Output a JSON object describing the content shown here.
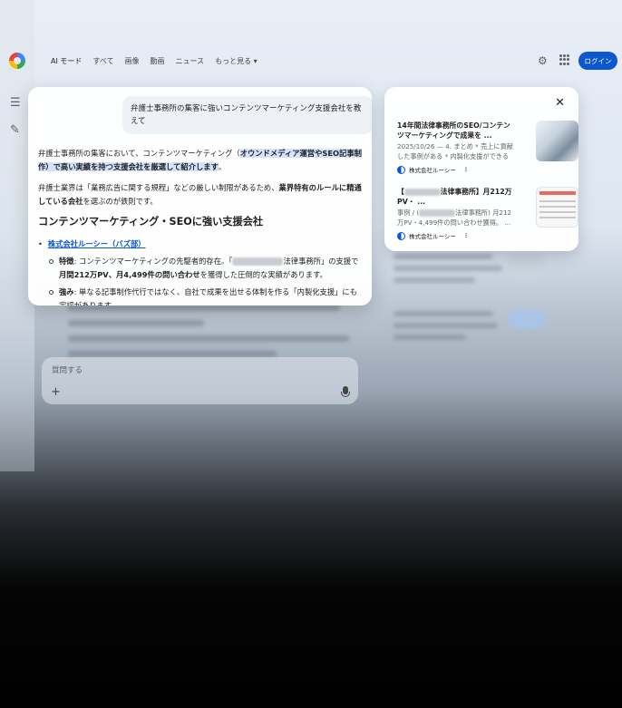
{
  "nav": {
    "tabs": [
      "AI モード",
      "すべて",
      "画像",
      "動画",
      "ニュース",
      "もっと見る ▾"
    ],
    "login_label": "ログイン"
  },
  "chat": {
    "query": "弁護士事務所の集客に強いコンテンツマーケティング支援会社を教えて",
    "intro_plain": "弁護士事務所の集客において、コンテンツマーケティング（",
    "intro_bold": "オウンドメディア運営やSEO記事制作）で高い実績を持つ支援会社を厳選して紹介します",
    "intro_end": "。",
    "para2_plain": "弁護士業界は「業務広告に関する規程」などの厳しい制限があるため、",
    "para2_bold": "業界特有のルールに精通している会社",
    "para2_end": "を選ぶのが鉄則です。",
    "heading": "コンテンツマーケティング・SEOに強い支援会社",
    "company": "株式会社ルーシー（バズ部）",
    "feature_label": "特徴",
    "feature_text_1": ": コンテンツマーケティングの先駆者的存在。「",
    "feature_text_2": "法律事務所」の支援で",
    "feature_bold": "月間212万PV、月4,499件の問い合わせ",
    "feature_end": "を獲得した圧倒的な実績があります。",
    "strength_label": "強み",
    "strength_text": ": 単なる記事制作代行ではなく、自社で成果を出せる体制を作る「内製化支援」にも定評があります。"
  },
  "sources": {
    "items": [
      {
        "title": "14年間法律事務所のSEO/コンテンツマーケティングで成果を ...",
        "snippet": "2025/10/26 — 4. まとめ * 売上に貢献した事例がある * 内製化支援ができる",
        "site": "株式会社ルーシー"
      },
      {
        "title_1": "【",
        "title_2": "法律事務所】月212万PV・ ...",
        "snippet_1": "事例 / (",
        "snippet_2": "法律事務所) 月212万PV・4,499件の問い合わせ獲得。 ...",
        "site": "株式会社ルーシー"
      }
    ]
  },
  "ask": {
    "placeholder": "質問する"
  }
}
